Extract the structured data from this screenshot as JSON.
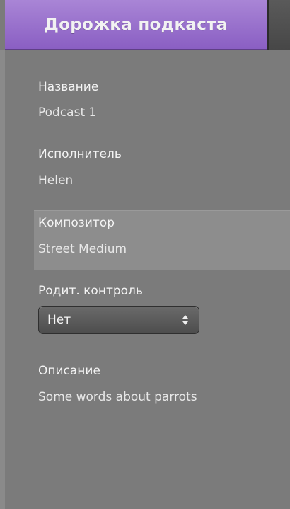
{
  "header": {
    "active_tab_label": "Дорожка подкаста"
  },
  "fields": {
    "name": {
      "label": "Название",
      "value": "Podcast 1"
    },
    "artist": {
      "label": "Исполнитель",
      "value": "Helen"
    },
    "composer": {
      "label": "Композитор",
      "value": "Street Medium"
    },
    "parental": {
      "label": "Родит. контроль",
      "selected": "Нет"
    },
    "description": {
      "label": "Описание",
      "value": "Some words about parrots"
    }
  },
  "colors": {
    "tab_accent": "#9a70cc",
    "panel_bg": "#7b7b7b",
    "text": "#f0f0f0"
  },
  "icons": {
    "select": "up-down-chevron-icon"
  }
}
